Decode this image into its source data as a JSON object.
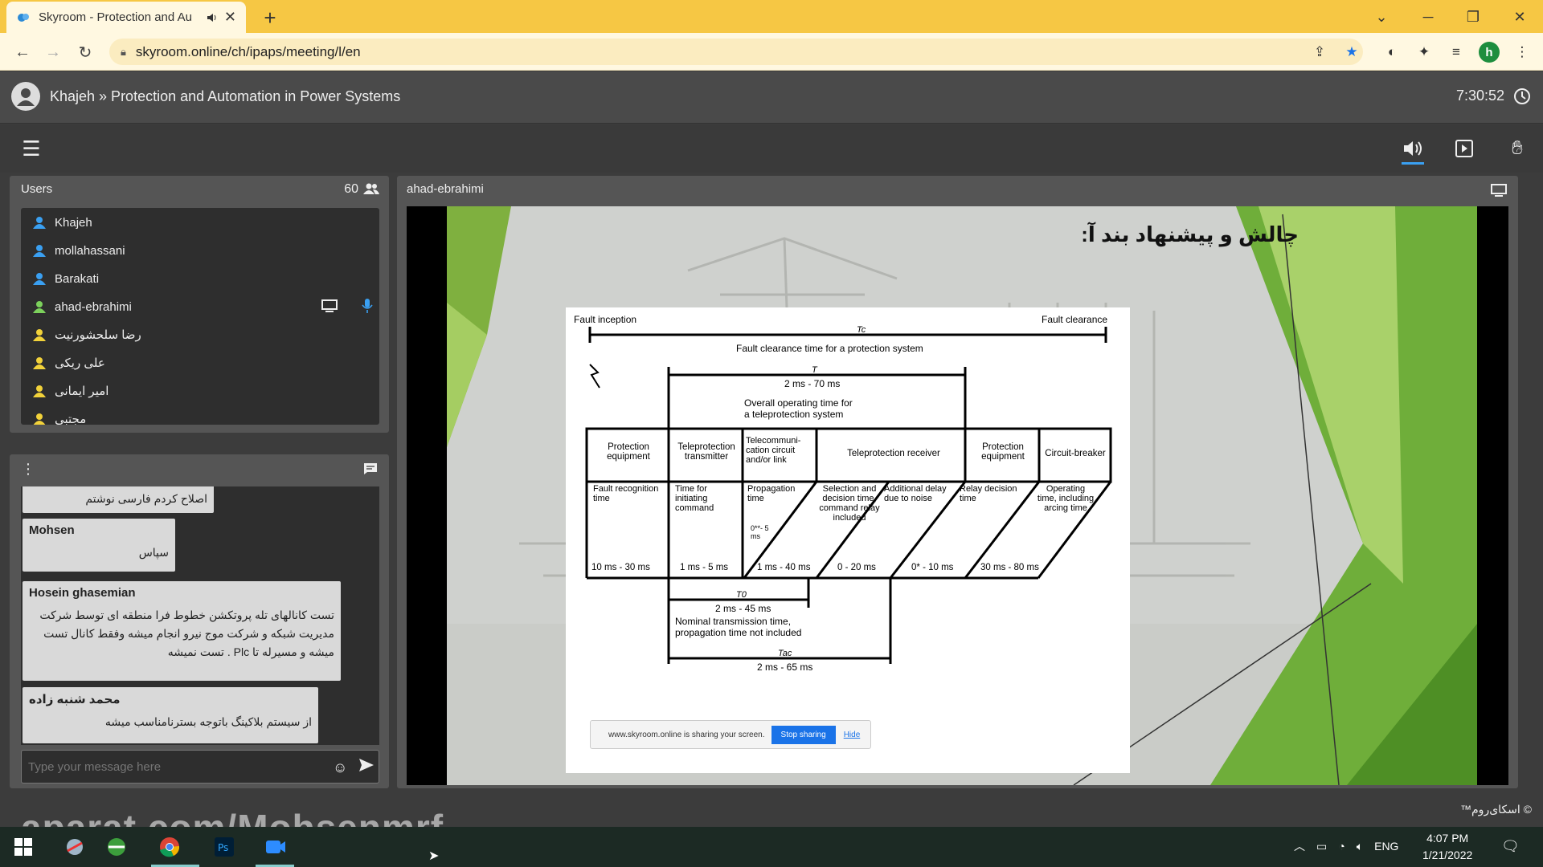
{
  "browser": {
    "tab_title": "Skyroom - Protection and Au",
    "tab_close": "✕",
    "new_tab": "+",
    "url": "skyroom.online/ch/ipaps/meeting/l/en",
    "profile_initial": "h",
    "icons": [
      "back-icon",
      "forward-icon",
      "reload-icon",
      "lock-icon",
      "share-icon",
      "star-icon",
      "extension-icon",
      "puzzle-icon",
      "media-icon",
      "kebab-icon"
    ]
  },
  "app": {
    "title": "Khajeh » Protection and Automation in Power Systems",
    "time": "7:30:52",
    "accent": "#3aa0f2"
  },
  "users": {
    "header": "Users",
    "count": "60",
    "list": [
      {
        "name": "Khajeh",
        "color": "#3aa0f2"
      },
      {
        "name": "mollahassani",
        "color": "#3aa0f2"
      },
      {
        "name": "Barakati",
        "color": "#3aa0f2"
      },
      {
        "name": "ahad-ebrahimi",
        "color": "#7cd15c"
      },
      {
        "name": "رضا سلحشورنیت",
        "color": "#f2d23a"
      },
      {
        "name": "علی ریکی",
        "color": "#f2d23a"
      },
      {
        "name": "امیر ایمانی",
        "color": "#f2d23a"
      },
      {
        "name": "مجتبی",
        "color": "#f2d23a"
      }
    ]
  },
  "chat": {
    "messages": [
      {
        "name": "",
        "text": "اصلاح کردم فارسی نوشتم"
      },
      {
        "name": "Mohsen",
        "text": "سپاس"
      },
      {
        "name": "Hosein ghasemian",
        "text": "تست کانالهای تله پروتکشن خطوط فرا منطقه ای توسط شرکت مدیریت شبکه و شرکت موج نیرو انجام میشه وفقط کانال تست میشه و مسیرله تا Plc . تست نمیشه"
      },
      {
        "name": "محمد شنبه زاده",
        "text": "از سیستم بلاکینگ باتوجه بسترنامناسب میشه"
      }
    ],
    "input_placeholder": "Type your message here"
  },
  "stage": {
    "presenter": "ahad-ebrahimi",
    "slide_title": "چالش و پیشنهاد بند آ:",
    "diagram": {
      "fault_inception": "Fault inception",
      "fault_clearance": "Fault clearance",
      "tc": "Tc",
      "tc_desc": "Fault clearance time for a protection system",
      "t": "T",
      "t_range": "2 ms - 70 ms",
      "t_desc1": "Overall operating time for",
      "t_desc2": "a teleprotection system",
      "boxes": [
        "Protection equipment",
        "Teleprotection transmitter",
        "Telecommuni-cation circuit and/or link",
        "Teleprotection receiver",
        "Protection equipment",
        "Circuit-breaker"
      ],
      "sub": [
        "Fault recognition time",
        "Time for initiating command",
        "Propagation time",
        "Selection and decision time, command relay included",
        "Additional delay due to noise",
        "Relay decision time",
        "Operating time, including arcing time"
      ],
      "prop_small": "0**- 5 ms",
      "ranges": [
        "10 ms - 30 ms",
        "1 ms - 5 ms",
        "1 ms - 40 ms",
        "0 - 20 ms",
        "0* - 10 ms",
        "30 ms - 80 ms"
      ],
      "t0": "T0",
      "t0_range": "2 ms - 45 ms",
      "t0_desc1": "Nominal transmission time,",
      "t0_desc2": "propagation time not included",
      "tac": "Tac",
      "tac_range": "2 ms - 65 ms"
    },
    "share_notice": "www.skyroom.online is sharing your screen.",
    "stop_label": "Stop sharing",
    "hide_label": "Hide"
  },
  "footer": {
    "brand": "© اسکای‌روم™",
    "watermark": "aparat.com/Mohsenmrf"
  },
  "taskbar": {
    "lang": "ENG",
    "time": "4:07 PM",
    "date": "1/21/2022"
  }
}
